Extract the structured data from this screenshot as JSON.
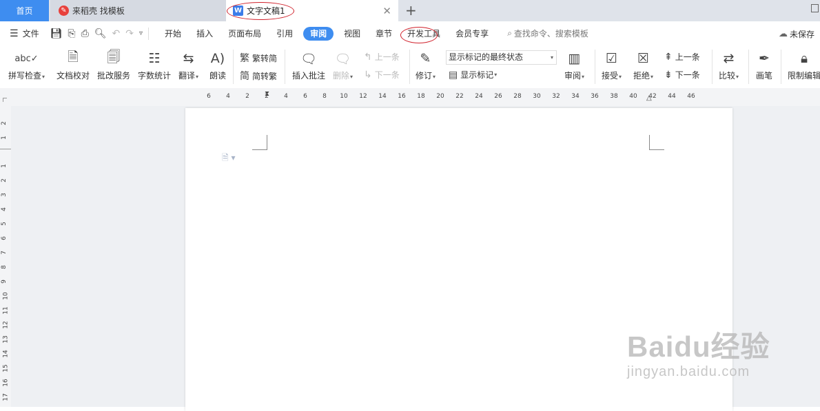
{
  "tabs": {
    "home": "首页",
    "daoke": "来稻壳 找模板",
    "doc": "文字文稿1",
    "doc_icon": "W"
  },
  "menu": {
    "file": "文件",
    "items": [
      "开始",
      "插入",
      "页面布局",
      "引用",
      "审阅",
      "视图",
      "章节",
      "开发工具",
      "会员专享"
    ],
    "active": "审阅",
    "search": "查找命令、搜索模板",
    "unsaved": "未保存"
  },
  "ribbon": {
    "spellcheck": "拼写检查",
    "doc_proof": "文档校对",
    "correction_service": "批改服务",
    "word_count": "字数统计",
    "translate": "翻译",
    "read_aloud": "朗读",
    "trad_to_simp": "繁转简",
    "simp_to_trad": "简转繁",
    "insert_comment": "插入批注",
    "delete": "删除",
    "prev_item": "上一条",
    "next_item": "下一条",
    "revise": "修订",
    "markup_state": "显示标记的最终状态",
    "show_markup": "显示标记",
    "review": "审阅",
    "accept": "接受",
    "reject": "拒绝",
    "prev_item2": "上一条",
    "next_item2": "下一条",
    "compare": "比较",
    "pen": "画笔",
    "restrict_edit": "限制编辑"
  },
  "ruler": {
    "h_ticks": [
      "6",
      "4",
      "2",
      "2",
      "4",
      "6",
      "8",
      "10",
      "12",
      "14",
      "16",
      "18",
      "20",
      "22",
      "24",
      "26",
      "28",
      "30",
      "32",
      "34",
      "36",
      "38",
      "40",
      "42",
      "44",
      "46"
    ],
    "v_ticks": [
      "2",
      "1",
      "1",
      "2",
      "3",
      "4",
      "5",
      "6",
      "7",
      "8",
      "9",
      "10",
      "11",
      "12",
      "13",
      "14",
      "15",
      "16",
      "17"
    ]
  },
  "watermark": {
    "line1": "Baidu经验",
    "line2": "jingyan.baidu.com"
  },
  "colors": {
    "accent": "#3e8df0",
    "annotation_circle": "#d0202a"
  }
}
